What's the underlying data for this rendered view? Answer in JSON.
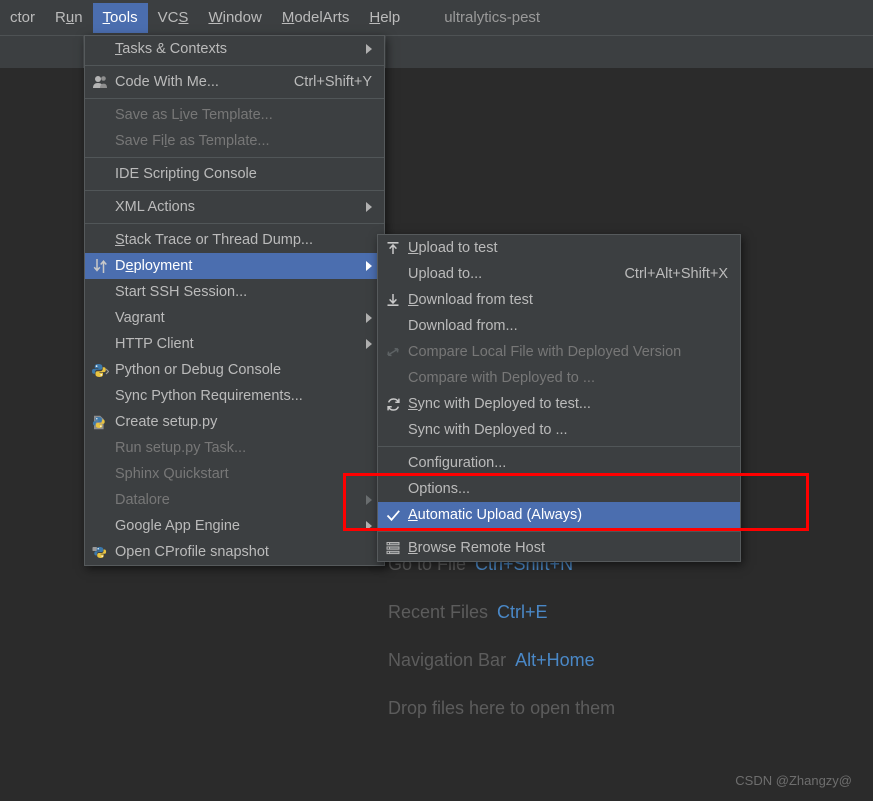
{
  "menubar": {
    "items": [
      {
        "label": "ctor",
        "underline": "",
        "active": false,
        "truncated": true
      },
      {
        "label": "Run",
        "underline": "u",
        "active": false
      },
      {
        "label": "Tools",
        "underline": "T",
        "active": true
      },
      {
        "label": "VCS",
        "underline": "S",
        "active": false
      },
      {
        "label": "Window",
        "underline": "W",
        "active": false
      },
      {
        "label": "ModelArts",
        "underline": "M",
        "active": false
      },
      {
        "label": "Help",
        "underline": "H",
        "active": false
      }
    ],
    "project_name": "ultralytics-pest"
  },
  "tools_menu": {
    "name": "Tools",
    "items": [
      {
        "type": "item",
        "label": "Tasks & Contexts",
        "underline": "T",
        "icon": "",
        "shortcut": "",
        "submenu": true,
        "disabled": false,
        "selected": false
      },
      {
        "type": "separator"
      },
      {
        "type": "item",
        "label": "Code With Me...",
        "underline": "",
        "icon": "people-icon",
        "shortcut": "Ctrl+Shift+Y",
        "submenu": false,
        "disabled": false,
        "selected": false
      },
      {
        "type": "separator"
      },
      {
        "type": "item",
        "label": "Save as Live Template...",
        "underline": "i",
        "icon": "",
        "shortcut": "",
        "submenu": false,
        "disabled": true,
        "selected": false
      },
      {
        "type": "item",
        "label": "Save File as Template...",
        "underline": "l",
        "icon": "",
        "shortcut": "",
        "submenu": false,
        "disabled": true,
        "selected": false
      },
      {
        "type": "separator"
      },
      {
        "type": "item",
        "label": "IDE Scripting Console",
        "underline": "",
        "icon": "",
        "shortcut": "",
        "submenu": false,
        "disabled": false,
        "selected": false
      },
      {
        "type": "separator"
      },
      {
        "type": "item",
        "label": "XML Actions",
        "underline": "",
        "icon": "",
        "shortcut": "",
        "submenu": true,
        "disabled": false,
        "selected": false
      },
      {
        "type": "separator"
      },
      {
        "type": "item",
        "label": "Stack Trace or Thread Dump...",
        "underline": "S",
        "icon": "",
        "shortcut": "",
        "submenu": false,
        "disabled": false,
        "selected": false
      },
      {
        "type": "item",
        "label": "Deployment",
        "underline": "e",
        "icon": "deployment-arrows-icon",
        "shortcut": "",
        "submenu": true,
        "disabled": false,
        "selected": true
      },
      {
        "type": "item",
        "label": "Start SSH Session...",
        "underline": "",
        "icon": "",
        "shortcut": "",
        "submenu": false,
        "disabled": false,
        "selected": false
      },
      {
        "type": "item",
        "label": "Vagrant",
        "underline": "",
        "icon": "",
        "shortcut": "",
        "submenu": true,
        "disabled": false,
        "selected": false
      },
      {
        "type": "item",
        "label": "HTTP Client",
        "underline": "",
        "icon": "",
        "shortcut": "",
        "submenu": true,
        "disabled": false,
        "selected": false
      },
      {
        "type": "item",
        "label": "Python or Debug Console",
        "underline": "",
        "icon": "python-console-icon",
        "shortcut": "",
        "submenu": false,
        "disabled": false,
        "selected": false
      },
      {
        "type": "item",
        "label": "Sync Python Requirements...",
        "underline": "",
        "icon": "",
        "shortcut": "",
        "submenu": false,
        "disabled": false,
        "selected": false
      },
      {
        "type": "item",
        "label": "Create setup.py",
        "underline": "",
        "icon": "python-file-icon",
        "shortcut": "",
        "submenu": false,
        "disabled": false,
        "selected": false
      },
      {
        "type": "item",
        "label": "Run setup.py Task...",
        "underline": "",
        "icon": "",
        "shortcut": "",
        "submenu": false,
        "disabled": true,
        "selected": false
      },
      {
        "type": "item",
        "label": "Sphinx Quickstart",
        "underline": "",
        "icon": "",
        "shortcut": "",
        "submenu": false,
        "disabled": true,
        "selected": false
      },
      {
        "type": "item",
        "label": "Datalore",
        "underline": "",
        "icon": "",
        "shortcut": "",
        "submenu": true,
        "disabled": true,
        "selected": false
      },
      {
        "type": "item",
        "label": "Google App Engine",
        "underline": "",
        "icon": "",
        "shortcut": "",
        "submenu": true,
        "disabled": false,
        "selected": false
      },
      {
        "type": "item",
        "label": "Open CProfile snapshot",
        "underline": "",
        "icon": "python-profile-icon",
        "shortcut": "",
        "submenu": false,
        "disabled": false,
        "selected": false
      }
    ]
  },
  "deployment_menu": {
    "name": "Deployment",
    "items": [
      {
        "type": "item",
        "label": "Upload to test",
        "underline": "U",
        "icon": "upload-icon",
        "shortcut": "",
        "submenu": false,
        "disabled": false,
        "selected": false,
        "checked": false
      },
      {
        "type": "item",
        "label": "Upload to...",
        "underline": "",
        "icon": "",
        "shortcut": "Ctrl+Alt+Shift+X",
        "submenu": false,
        "disabled": false,
        "selected": false,
        "checked": false
      },
      {
        "type": "item",
        "label": "Download from test",
        "underline": "D",
        "icon": "download-icon",
        "shortcut": "",
        "submenu": false,
        "disabled": false,
        "selected": false,
        "checked": false
      },
      {
        "type": "item",
        "label": "Download from...",
        "underline": "",
        "icon": "",
        "shortcut": "",
        "submenu": false,
        "disabled": false,
        "selected": false,
        "checked": false
      },
      {
        "type": "item",
        "label": "Compare Local File with Deployed Version",
        "underline": "",
        "icon": "compare-icon",
        "shortcut": "",
        "submenu": false,
        "disabled": true,
        "selected": false,
        "checked": false
      },
      {
        "type": "item",
        "label": "Compare with Deployed to ...",
        "underline": "",
        "icon": "",
        "shortcut": "",
        "submenu": false,
        "disabled": true,
        "selected": false,
        "checked": false
      },
      {
        "type": "item",
        "label": "Sync with Deployed to test...",
        "underline": "S",
        "icon": "sync-icon",
        "shortcut": "",
        "submenu": false,
        "disabled": false,
        "selected": false,
        "checked": false
      },
      {
        "type": "item",
        "label": "Sync with Deployed to ...",
        "underline": "",
        "icon": "",
        "shortcut": "",
        "submenu": false,
        "disabled": false,
        "selected": false,
        "checked": false
      },
      {
        "type": "separator"
      },
      {
        "type": "item",
        "label": "Configuration...",
        "underline": "",
        "icon": "",
        "shortcut": "",
        "submenu": false,
        "disabled": false,
        "selected": false,
        "checked": false
      },
      {
        "type": "item",
        "label": "Options...",
        "underline": "",
        "icon": "",
        "shortcut": "",
        "submenu": false,
        "disabled": false,
        "selected": false,
        "checked": false
      },
      {
        "type": "item",
        "label": "Automatic Upload (Always)",
        "underline": "A",
        "icon": "check-icon",
        "shortcut": "",
        "submenu": false,
        "disabled": false,
        "selected": true,
        "checked": true
      },
      {
        "type": "separator"
      },
      {
        "type": "item",
        "label": "Browse Remote Host",
        "underline": "B",
        "icon": "remote-host-icon",
        "shortcut": "",
        "submenu": false,
        "disabled": false,
        "selected": false,
        "checked": false
      }
    ]
  },
  "editor_hints": {
    "rows": [
      {
        "label": "Go to File",
        "key": "Ctrl+Shift+N"
      },
      {
        "label": "Recent Files",
        "key": "Ctrl+E"
      },
      {
        "label": "Navigation Bar",
        "key": "Alt+Home"
      },
      {
        "label": "Drop files here to open them",
        "key": ""
      }
    ]
  },
  "watermark": "CSDN @Zhangzy@",
  "colors": {
    "menu_background": "#3c3f41",
    "editor_background": "#2b2b2b",
    "selection_blue": "#4b6eaf",
    "text": "#bbbbbb",
    "text_disabled": "#777777",
    "shortcut_blue": "#4a88c7",
    "annotation_red": "#ff0000"
  }
}
